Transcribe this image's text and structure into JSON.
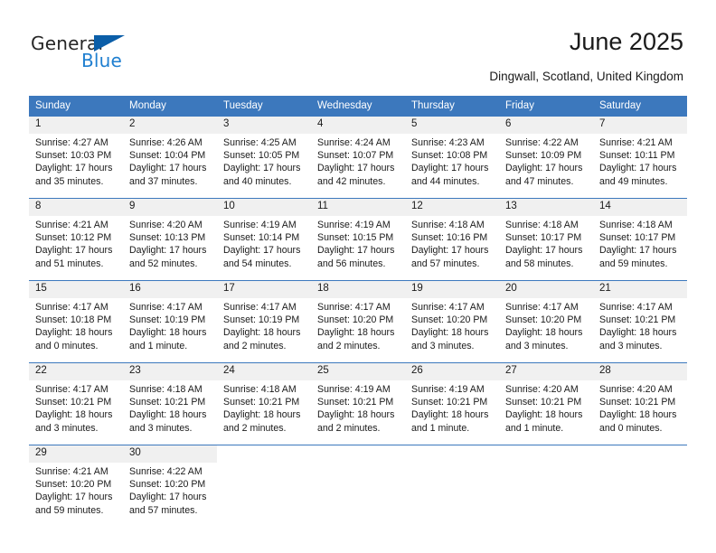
{
  "brand": {
    "name_part1": "General",
    "name_part2": "Blue",
    "flag_icon": "blue-triangle-flag-icon"
  },
  "header": {
    "title": "June 2025",
    "location": "Dingwall, Scotland, United Kingdom"
  },
  "colors": {
    "header_blue": "#3c78bd",
    "brand_blue": "#1f7fd0",
    "flag_blue": "#0b5ea8",
    "daynum_band": "#f0f0f0",
    "row_separator": "#3c78bd"
  },
  "calendar": {
    "weekday_headers": [
      "Sunday",
      "Monday",
      "Tuesday",
      "Wednesday",
      "Thursday",
      "Friday",
      "Saturday"
    ],
    "weeks": [
      [
        {
          "day": "1",
          "sunrise": "Sunrise: 4:27 AM",
          "sunset": "Sunset: 10:03 PM",
          "daylight_line1": "Daylight: 17 hours",
          "daylight_line2": "and 35 minutes."
        },
        {
          "day": "2",
          "sunrise": "Sunrise: 4:26 AM",
          "sunset": "Sunset: 10:04 PM",
          "daylight_line1": "Daylight: 17 hours",
          "daylight_line2": "and 37 minutes."
        },
        {
          "day": "3",
          "sunrise": "Sunrise: 4:25 AM",
          "sunset": "Sunset: 10:05 PM",
          "daylight_line1": "Daylight: 17 hours",
          "daylight_line2": "and 40 minutes."
        },
        {
          "day": "4",
          "sunrise": "Sunrise: 4:24 AM",
          "sunset": "Sunset: 10:07 PM",
          "daylight_line1": "Daylight: 17 hours",
          "daylight_line2": "and 42 minutes."
        },
        {
          "day": "5",
          "sunrise": "Sunrise: 4:23 AM",
          "sunset": "Sunset: 10:08 PM",
          "daylight_line1": "Daylight: 17 hours",
          "daylight_line2": "and 44 minutes."
        },
        {
          "day": "6",
          "sunrise": "Sunrise: 4:22 AM",
          "sunset": "Sunset: 10:09 PM",
          "daylight_line1": "Daylight: 17 hours",
          "daylight_line2": "and 47 minutes."
        },
        {
          "day": "7",
          "sunrise": "Sunrise: 4:21 AM",
          "sunset": "Sunset: 10:11 PM",
          "daylight_line1": "Daylight: 17 hours",
          "daylight_line2": "and 49 minutes."
        }
      ],
      [
        {
          "day": "8",
          "sunrise": "Sunrise: 4:21 AM",
          "sunset": "Sunset: 10:12 PM",
          "daylight_line1": "Daylight: 17 hours",
          "daylight_line2": "and 51 minutes."
        },
        {
          "day": "9",
          "sunrise": "Sunrise: 4:20 AM",
          "sunset": "Sunset: 10:13 PM",
          "daylight_line1": "Daylight: 17 hours",
          "daylight_line2": "and 52 minutes."
        },
        {
          "day": "10",
          "sunrise": "Sunrise: 4:19 AM",
          "sunset": "Sunset: 10:14 PM",
          "daylight_line1": "Daylight: 17 hours",
          "daylight_line2": "and 54 minutes."
        },
        {
          "day": "11",
          "sunrise": "Sunrise: 4:19 AM",
          "sunset": "Sunset: 10:15 PM",
          "daylight_line1": "Daylight: 17 hours",
          "daylight_line2": "and 56 minutes."
        },
        {
          "day": "12",
          "sunrise": "Sunrise: 4:18 AM",
          "sunset": "Sunset: 10:16 PM",
          "daylight_line1": "Daylight: 17 hours",
          "daylight_line2": "and 57 minutes."
        },
        {
          "day": "13",
          "sunrise": "Sunrise: 4:18 AM",
          "sunset": "Sunset: 10:17 PM",
          "daylight_line1": "Daylight: 17 hours",
          "daylight_line2": "and 58 minutes."
        },
        {
          "day": "14",
          "sunrise": "Sunrise: 4:18 AM",
          "sunset": "Sunset: 10:17 PM",
          "daylight_line1": "Daylight: 17 hours",
          "daylight_line2": "and 59 minutes."
        }
      ],
      [
        {
          "day": "15",
          "sunrise": "Sunrise: 4:17 AM",
          "sunset": "Sunset: 10:18 PM",
          "daylight_line1": "Daylight: 18 hours",
          "daylight_line2": "and 0 minutes."
        },
        {
          "day": "16",
          "sunrise": "Sunrise: 4:17 AM",
          "sunset": "Sunset: 10:19 PM",
          "daylight_line1": "Daylight: 18 hours",
          "daylight_line2": "and 1 minute."
        },
        {
          "day": "17",
          "sunrise": "Sunrise: 4:17 AM",
          "sunset": "Sunset: 10:19 PM",
          "daylight_line1": "Daylight: 18 hours",
          "daylight_line2": "and 2 minutes."
        },
        {
          "day": "18",
          "sunrise": "Sunrise: 4:17 AM",
          "sunset": "Sunset: 10:20 PM",
          "daylight_line1": "Daylight: 18 hours",
          "daylight_line2": "and 2 minutes."
        },
        {
          "day": "19",
          "sunrise": "Sunrise: 4:17 AM",
          "sunset": "Sunset: 10:20 PM",
          "daylight_line1": "Daylight: 18 hours",
          "daylight_line2": "and 3 minutes."
        },
        {
          "day": "20",
          "sunrise": "Sunrise: 4:17 AM",
          "sunset": "Sunset: 10:20 PM",
          "daylight_line1": "Daylight: 18 hours",
          "daylight_line2": "and 3 minutes."
        },
        {
          "day": "21",
          "sunrise": "Sunrise: 4:17 AM",
          "sunset": "Sunset: 10:21 PM",
          "daylight_line1": "Daylight: 18 hours",
          "daylight_line2": "and 3 minutes."
        }
      ],
      [
        {
          "day": "22",
          "sunrise": "Sunrise: 4:17 AM",
          "sunset": "Sunset: 10:21 PM",
          "daylight_line1": "Daylight: 18 hours",
          "daylight_line2": "and 3 minutes."
        },
        {
          "day": "23",
          "sunrise": "Sunrise: 4:18 AM",
          "sunset": "Sunset: 10:21 PM",
          "daylight_line1": "Daylight: 18 hours",
          "daylight_line2": "and 3 minutes."
        },
        {
          "day": "24",
          "sunrise": "Sunrise: 4:18 AM",
          "sunset": "Sunset: 10:21 PM",
          "daylight_line1": "Daylight: 18 hours",
          "daylight_line2": "and 2 minutes."
        },
        {
          "day": "25",
          "sunrise": "Sunrise: 4:19 AM",
          "sunset": "Sunset: 10:21 PM",
          "daylight_line1": "Daylight: 18 hours",
          "daylight_line2": "and 2 minutes."
        },
        {
          "day": "26",
          "sunrise": "Sunrise: 4:19 AM",
          "sunset": "Sunset: 10:21 PM",
          "daylight_line1": "Daylight: 18 hours",
          "daylight_line2": "and 1 minute."
        },
        {
          "day": "27",
          "sunrise": "Sunrise: 4:20 AM",
          "sunset": "Sunset: 10:21 PM",
          "daylight_line1": "Daylight: 18 hours",
          "daylight_line2": "and 1 minute."
        },
        {
          "day": "28",
          "sunrise": "Sunrise: 4:20 AM",
          "sunset": "Sunset: 10:21 PM",
          "daylight_line1": "Daylight: 18 hours",
          "daylight_line2": "and 0 minutes."
        }
      ],
      [
        {
          "day": "29",
          "sunrise": "Sunrise: 4:21 AM",
          "sunset": "Sunset: 10:20 PM",
          "daylight_line1": "Daylight: 17 hours",
          "daylight_line2": "and 59 minutes."
        },
        {
          "day": "30",
          "sunrise": "Sunrise: 4:22 AM",
          "sunset": "Sunset: 10:20 PM",
          "daylight_line1": "Daylight: 17 hours",
          "daylight_line2": "and 57 minutes."
        },
        {
          "day": "",
          "sunrise": "",
          "sunset": "",
          "daylight_line1": "",
          "daylight_line2": ""
        },
        {
          "day": "",
          "sunrise": "",
          "sunset": "",
          "daylight_line1": "",
          "daylight_line2": ""
        },
        {
          "day": "",
          "sunrise": "",
          "sunset": "",
          "daylight_line1": "",
          "daylight_line2": ""
        },
        {
          "day": "",
          "sunrise": "",
          "sunset": "",
          "daylight_line1": "",
          "daylight_line2": ""
        },
        {
          "day": "",
          "sunrise": "",
          "sunset": "",
          "daylight_line1": "",
          "daylight_line2": ""
        }
      ]
    ]
  }
}
